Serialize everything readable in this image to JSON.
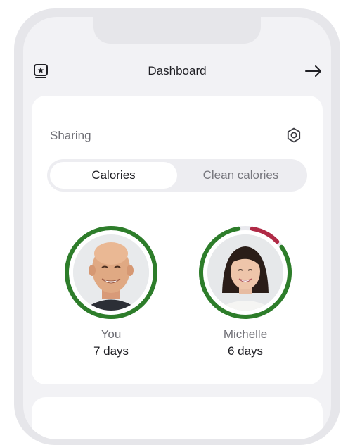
{
  "header": {
    "title": "Dashboard",
    "left_icon": "star-badge-icon",
    "right_icon": "arrow-right-icon"
  },
  "sharing": {
    "label": "Sharing",
    "settings_icon": "gear-icon",
    "tabs": [
      {
        "label": "Calories",
        "active": true
      },
      {
        "label": "Clean calories",
        "active": false
      }
    ],
    "people": [
      {
        "name": "You",
        "days": "7 days",
        "ring_green_fraction": 1.0,
        "ring_red_fraction": 0.0
      },
      {
        "name": "Michelle",
        "days": "6 days",
        "ring_green_fraction": 0.86,
        "ring_red_fraction": 0.14
      }
    ]
  },
  "colors": {
    "ring_green": "#2d7d2a",
    "ring_red": "#b02a46",
    "text_primary": "#1f1f24",
    "text_secondary": "#6f6f76"
  }
}
